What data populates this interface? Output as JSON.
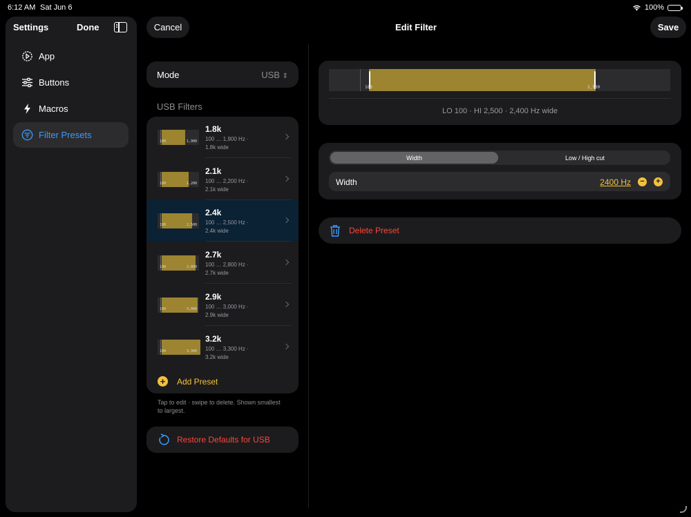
{
  "status": {
    "time": "6:12 AM",
    "date": "Sat Jun 6",
    "battery": "100%"
  },
  "sidebar": {
    "title": "Settings",
    "done_label": "Done",
    "items": [
      {
        "label": "App",
        "icon": "app-gear-icon"
      },
      {
        "label": "Buttons",
        "icon": "sliders-icon"
      },
      {
        "label": "Macros",
        "icon": "bolt-icon"
      },
      {
        "label": "Filter Presets",
        "icon": "filter-icon",
        "active": true
      }
    ]
  },
  "mode": {
    "label": "Mode",
    "value": "USB"
  },
  "filters": {
    "section_label": "USB Filters",
    "presets": [
      {
        "title": "1.8k",
        "lo": 100,
        "hi": 1900,
        "range": "100 … 1,900 Hz ·",
        "width": "1.8k wide",
        "thumb_lo": "100",
        "thumb_hi": "1,900"
      },
      {
        "title": "2.1k",
        "lo": 100,
        "hi": 2200,
        "range": "100 … 2,200 Hz ·",
        "width": "2.1k wide",
        "thumb_lo": "100",
        "thumb_hi": "2,200"
      },
      {
        "title": "2.4k",
        "lo": 100,
        "hi": 2500,
        "range": "100 … 2,500 Hz ·",
        "width": "2.4k wide",
        "thumb_lo": "100",
        "thumb_hi": "2,500",
        "selected": true
      },
      {
        "title": "2.7k",
        "lo": 100,
        "hi": 2800,
        "range": "100 … 2,800 Hz ·",
        "width": "2.7k wide",
        "thumb_lo": "100",
        "thumb_hi": "2,800"
      },
      {
        "title": "2.9k",
        "lo": 100,
        "hi": 3000,
        "range": "100 … 3,000 Hz ·",
        "width": "2.9k wide",
        "thumb_lo": "100",
        "thumb_hi": "3,000"
      },
      {
        "title": "3.2k",
        "lo": 100,
        "hi": 3300,
        "range": "100 … 3,300 Hz ·",
        "width": "3.2k wide",
        "thumb_lo": "100",
        "thumb_hi": "3,300"
      }
    ],
    "add_label": "Add Preset",
    "help_text": "Tap to edit · swipe to delete. Shown smallest to largest.",
    "restore_label": "Restore Defaults for USB"
  },
  "editor": {
    "cancel_label": "Cancel",
    "title": "Edit Filter",
    "save_label": "Save",
    "preview": {
      "lo": 100,
      "hi": 2500,
      "lo_label": "100",
      "hi_label": "2,500",
      "caption": "LO 100 · HI 2,500 · 2,400 Hz wide"
    },
    "segments": [
      "Width",
      "Low / High cut"
    ],
    "selected_segment": "Width",
    "width_label": "Width",
    "width_value": "2400 Hz",
    "delete_label": "Delete Preset"
  },
  "colors": {
    "accent": "#f2c23c",
    "filter_bar": "#9c8431",
    "link_blue": "#3d9bff",
    "destructive": "#ff453a",
    "selected_row": "#0b2134"
  }
}
